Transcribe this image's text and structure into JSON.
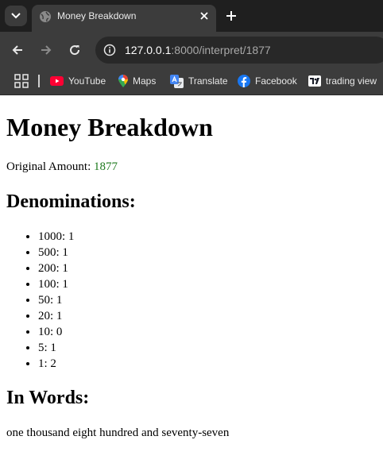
{
  "browser": {
    "tab_title": "Money Breakdown",
    "url_host": "127.0.0.1",
    "url_path": ":8000/interpret/1877",
    "bookmarks": [
      {
        "label": "YouTube",
        "icon": "youtube-icon"
      },
      {
        "label": "Maps",
        "icon": "maps-pin-icon"
      },
      {
        "label": "Translate",
        "icon": "translate-icon"
      },
      {
        "label": "Facebook",
        "icon": "facebook-icon"
      },
      {
        "label": "trading view",
        "icon": "tradingview-icon"
      }
    ],
    "colors": {
      "chrome": "#3c3c3c",
      "tabbar": "#1f1f1f",
      "omnibox": "#282828"
    }
  },
  "page": {
    "title": "Money Breakdown",
    "original_label": "Original Amount: ",
    "original_value": "1877",
    "original_value_color": "#1e7a1e",
    "denominations_heading": "Denominations:",
    "denominations": [
      "1000: 1",
      "500: 1",
      "200: 1",
      "100: 1",
      "50: 1",
      "20: 1",
      "10: 0",
      "5: 1",
      "1: 2"
    ],
    "words_heading": "In Words:",
    "words": "one thousand eight hundred and seventy-seven"
  }
}
